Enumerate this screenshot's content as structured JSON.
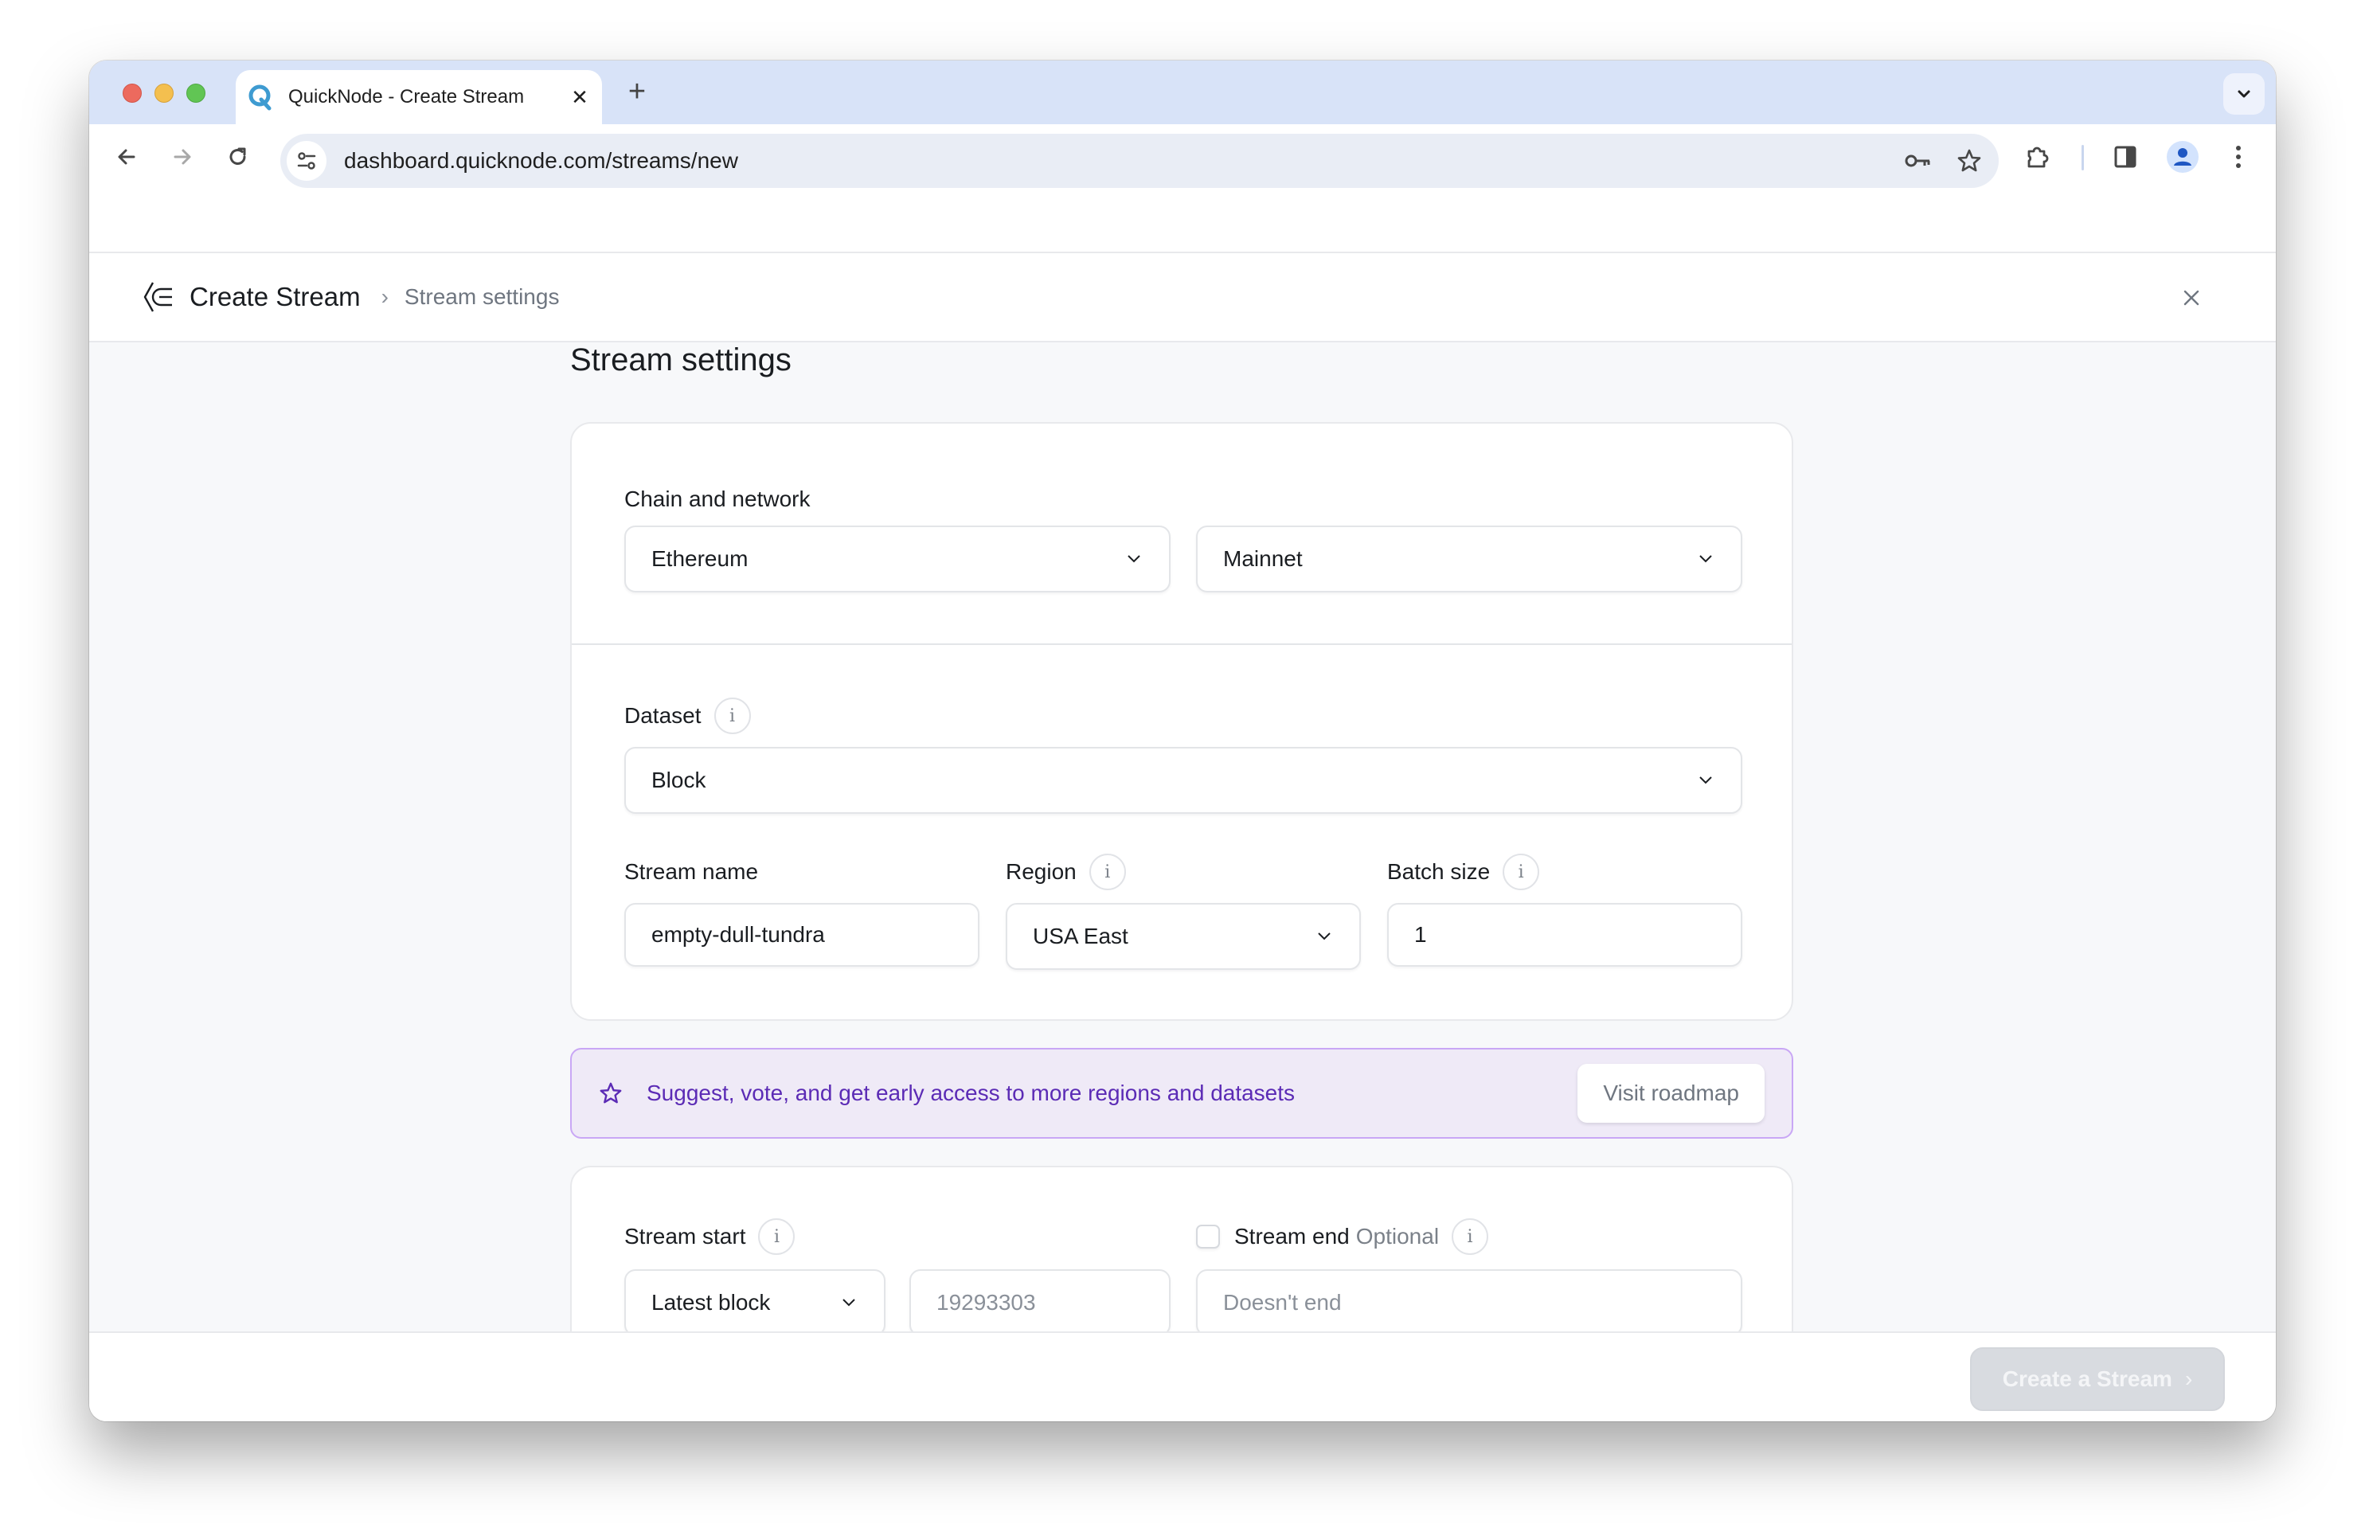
{
  "browser": {
    "tab_title": "QuickNode - Create Stream",
    "url": "dashboard.quicknode.com/streams/new",
    "icons": {
      "favicon": "quicknode-q-icon",
      "tab_close": "close-icon",
      "new_tab": "plus-icon",
      "tab_search": "chevron-down-icon",
      "back": "arrow-left-icon",
      "forward": "arrow-right-icon",
      "reload": "reload-icon",
      "site_info": "tune-icon",
      "password": "key-icon",
      "bookmark": "star-outline-icon",
      "extensions": "puzzle-icon",
      "side_panel": "side-panel-icon",
      "profile": "person-icon",
      "menu": "more-vertical-icon"
    },
    "tab_close_glyph": "✕",
    "new_tab_glyph": "+"
  },
  "header": {
    "title": "Create Stream",
    "separator": "›",
    "current": "Stream settings",
    "close_glyph": "✕"
  },
  "main": {
    "page_title": "Stream settings",
    "chain_network": {
      "label": "Chain and network",
      "chain_value": "Ethereum",
      "network_value": "Mainnet"
    },
    "dataset": {
      "label": "Dataset",
      "info_glyph": "i",
      "value": "Block"
    },
    "stream_name": {
      "label": "Stream name",
      "value": "empty-dull-tundra"
    },
    "region": {
      "label": "Region",
      "info_glyph": "i",
      "value": "USA East"
    },
    "batch_size": {
      "label": "Batch size",
      "info_glyph": "i",
      "value": "1"
    },
    "banner": {
      "text": "Suggest, vote, and get early access to more regions and datasets",
      "button_label": "Visit roadmap",
      "accent_color": "#5b2bb5"
    },
    "stream_start": {
      "label": "Stream start",
      "info_glyph": "i",
      "mode_value": "Latest block",
      "block_placeholder": "19293303"
    },
    "stream_end": {
      "checked": false,
      "label": "Stream end",
      "optional_label": "Optional",
      "info_glyph": "i",
      "placeholder": "Doesn't end"
    }
  },
  "footer": {
    "create_button_label": "Create a Stream",
    "create_button_glyph": "›",
    "create_button_disabled": true
  }
}
